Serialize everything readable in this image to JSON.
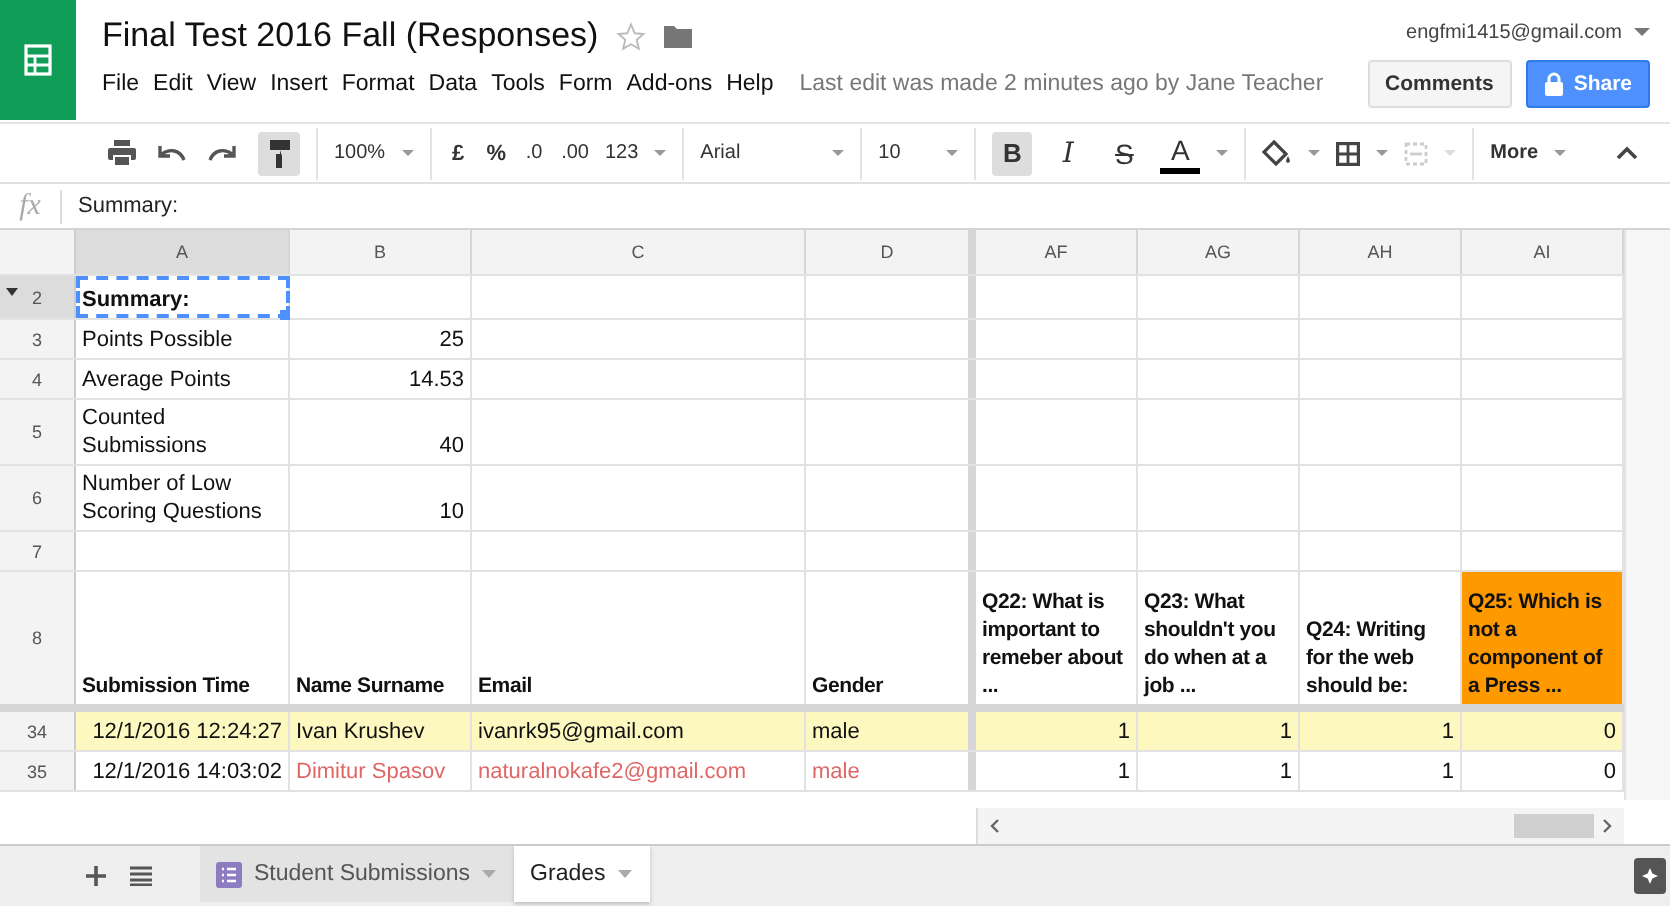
{
  "document": {
    "title": "Final Test 2016 Fall (Responses)",
    "starred": false,
    "account": "engfmi1415@gmail.com",
    "last_edit": "Last edit was made 2 minutes ago by Jane Teacher",
    "comments_button": "Comments",
    "share_button": "Share"
  },
  "menu": [
    "File",
    "Edit",
    "View",
    "Insert",
    "Format",
    "Data",
    "Tools",
    "Form",
    "Add-ons",
    "Help"
  ],
  "toolbar": {
    "paint_format_selected": true,
    "zoom": "100%",
    "currency": "£",
    "percent": "%",
    "decrease_decimals": ".0",
    "increase_decimals": ".00",
    "number_format": "123",
    "font": "Arial",
    "font_size": "10",
    "styles": [
      {
        "kind": "bold",
        "label": "B",
        "selected": true
      },
      {
        "kind": "italic",
        "label": "I",
        "selected": false
      },
      {
        "kind": "strike",
        "label": "S",
        "selected": false
      },
      {
        "kind": "color",
        "label": "A",
        "selected": false
      }
    ],
    "more": "More"
  },
  "formula_bar": {
    "label": "fx",
    "value": "Summary:"
  },
  "columns": [
    {
      "label": "A",
      "selected": true,
      "freeze_line_after": false
    },
    {
      "label": "B",
      "selected": false,
      "freeze_line_after": false
    },
    {
      "label": "C",
      "selected": false,
      "freeze_line_after": false
    },
    {
      "label": "D",
      "selected": false,
      "freeze_line_after": true
    },
    {
      "label": "AF",
      "selected": false,
      "freeze_line_after": false
    },
    {
      "label": "AG",
      "selected": false,
      "freeze_line_after": false
    },
    {
      "label": "AH",
      "selected": false,
      "freeze_line_after": false
    },
    {
      "label": "AI",
      "selected": false,
      "freeze_line_after": false
    }
  ],
  "rows": [
    {
      "number": "2",
      "selected": true,
      "freeze_line_after": false,
      "highlighted": false,
      "kind": "title",
      "cells": [
        {
          "text": "Summary:",
          "kind": "text",
          "selected": true
        },
        {
          "selected": false
        },
        {
          "selected": false
        },
        {
          "selected": false
        },
        {
          "selected": false
        },
        {
          "selected": false
        },
        {
          "selected": false
        },
        {
          "selected": false
        }
      ]
    },
    {
      "number": "3",
      "selected": false,
      "freeze_line_after": false,
      "highlighted": false,
      "kind": "data",
      "cells": [
        {
          "text": "Points Possible",
          "kind": "text",
          "selected": false
        },
        {
          "text": "25",
          "kind": "number",
          "selected": false
        },
        {
          "selected": false
        },
        {
          "selected": false
        },
        {
          "selected": false
        },
        {
          "selected": false
        },
        {
          "selected": false
        },
        {
          "selected": false
        }
      ]
    },
    {
      "number": "4",
      "selected": false,
      "freeze_line_after": false,
      "highlighted": false,
      "kind": "data",
      "cells": [
        {
          "text": "Average Points",
          "kind": "text",
          "selected": false
        },
        {
          "text": "14.53",
          "kind": "number",
          "selected": false
        },
        {
          "selected": false
        },
        {
          "selected": false
        },
        {
          "selected": false
        },
        {
          "selected": false
        },
        {
          "selected": false
        },
        {
          "selected": false
        }
      ]
    },
    {
      "number": "5",
      "selected": false,
      "freeze_line_after": false,
      "highlighted": false,
      "kind": "data",
      "cells": [
        {
          "text": "Counted Submissions",
          "kind": "text",
          "selected": false
        },
        {
          "text": "40",
          "kind": "number",
          "selected": false
        },
        {
          "selected": false
        },
        {
          "selected": false
        },
        {
          "selected": false
        },
        {
          "selected": false
        },
        {
          "selected": false
        },
        {
          "selected": false
        }
      ]
    },
    {
      "number": "6",
      "selected": false,
      "freeze_line_after": false,
      "highlighted": false,
      "kind": "data",
      "cells": [
        {
          "text": "Number of Low Scoring Questions",
          "kind": "text",
          "selected": false
        },
        {
          "text": "10",
          "kind": "number",
          "selected": false
        },
        {
          "selected": false
        },
        {
          "selected": false
        },
        {
          "selected": false
        },
        {
          "selected": false
        },
        {
          "selected": false
        },
        {
          "selected": false
        }
      ]
    },
    {
      "number": "7",
      "selected": false,
      "freeze_line_after": false,
      "highlighted": false,
      "kind": "data",
      "cells": [
        {
          "selected": false
        },
        {
          "selected": false
        },
        {
          "selected": false
        },
        {
          "selected": false
        },
        {
          "selected": false
        },
        {
          "selected": false
        },
        {
          "selected": false
        },
        {
          "selected": false
        }
      ]
    },
    {
      "number": "8",
      "selected": false,
      "freeze_line_after": true,
      "highlighted": false,
      "kind": "header",
      "cells": [
        {
          "text": "Submission Time",
          "kind": "text",
          "selected": false
        },
        {
          "text": "Name Surname",
          "kind": "text",
          "selected": false
        },
        {
          "text": "Email",
          "kind": "text",
          "selected": false
        },
        {
          "text": "Gender",
          "kind": "text",
          "selected": false
        },
        {
          "text": "Q22: What is important to remeber about ...",
          "kind": "text",
          "selected": false
        },
        {
          "text": "Q23: What shouldn't you do when at a job ...",
          "kind": "text",
          "selected": false
        },
        {
          "text": "Q24: Writing for the web should be:",
          "kind": "text",
          "selected": false
        },
        {
          "text": "Q25: Which is not a component of a Press ...",
          "kind": "text",
          "selected": false,
          "highlighted": true
        }
      ]
    },
    {
      "number": "34",
      "selected": false,
      "freeze_line_after": false,
      "highlighted": true,
      "kind": "data",
      "cells": [
        {
          "text": "12/1/2016 12:24:27",
          "kind": "number",
          "selected": false
        },
        {
          "text": "Ivan Krushev",
          "kind": "text",
          "selected": false
        },
        {
          "text": "ivanrk95@gmail.com",
          "kind": "text",
          "selected": false
        },
        {
          "text": "male",
          "kind": "text",
          "selected": false
        },
        {
          "text": "1",
          "kind": "number",
          "selected": false
        },
        {
          "text": "1",
          "kind": "number",
          "selected": false
        },
        {
          "text": "1",
          "kind": "number",
          "selected": false
        },
        {
          "text": "0",
          "kind": "number",
          "selected": false
        }
      ]
    },
    {
      "number": "35",
      "selected": false,
      "freeze_line_after": false,
      "highlighted": false,
      "kind": "data",
      "cells": [
        {
          "text": "12/1/2016 14:03:02",
          "kind": "number",
          "selected": false
        },
        {
          "text": "Dimitur Spasov",
          "kind": "text",
          "selected": false,
          "color": "#e06666"
        },
        {
          "text": "naturalnokafe2@gmail.com",
          "kind": "text",
          "selected": false,
          "color": "#e06666"
        },
        {
          "text": "male",
          "kind": "text",
          "selected": false,
          "color": "#e06666"
        },
        {
          "text": "1",
          "kind": "number",
          "selected": false
        },
        {
          "text": "1",
          "kind": "number",
          "selected": false
        },
        {
          "text": "1",
          "kind": "number",
          "selected": false
        },
        {
          "text": "0",
          "kind": "number",
          "selected": false
        }
      ]
    }
  ],
  "sheet_tabs": [
    {
      "label": "Student Submissions",
      "kind": "form",
      "selected": false
    },
    {
      "label": "Grades",
      "kind": "plain",
      "selected": true
    }
  ]
}
